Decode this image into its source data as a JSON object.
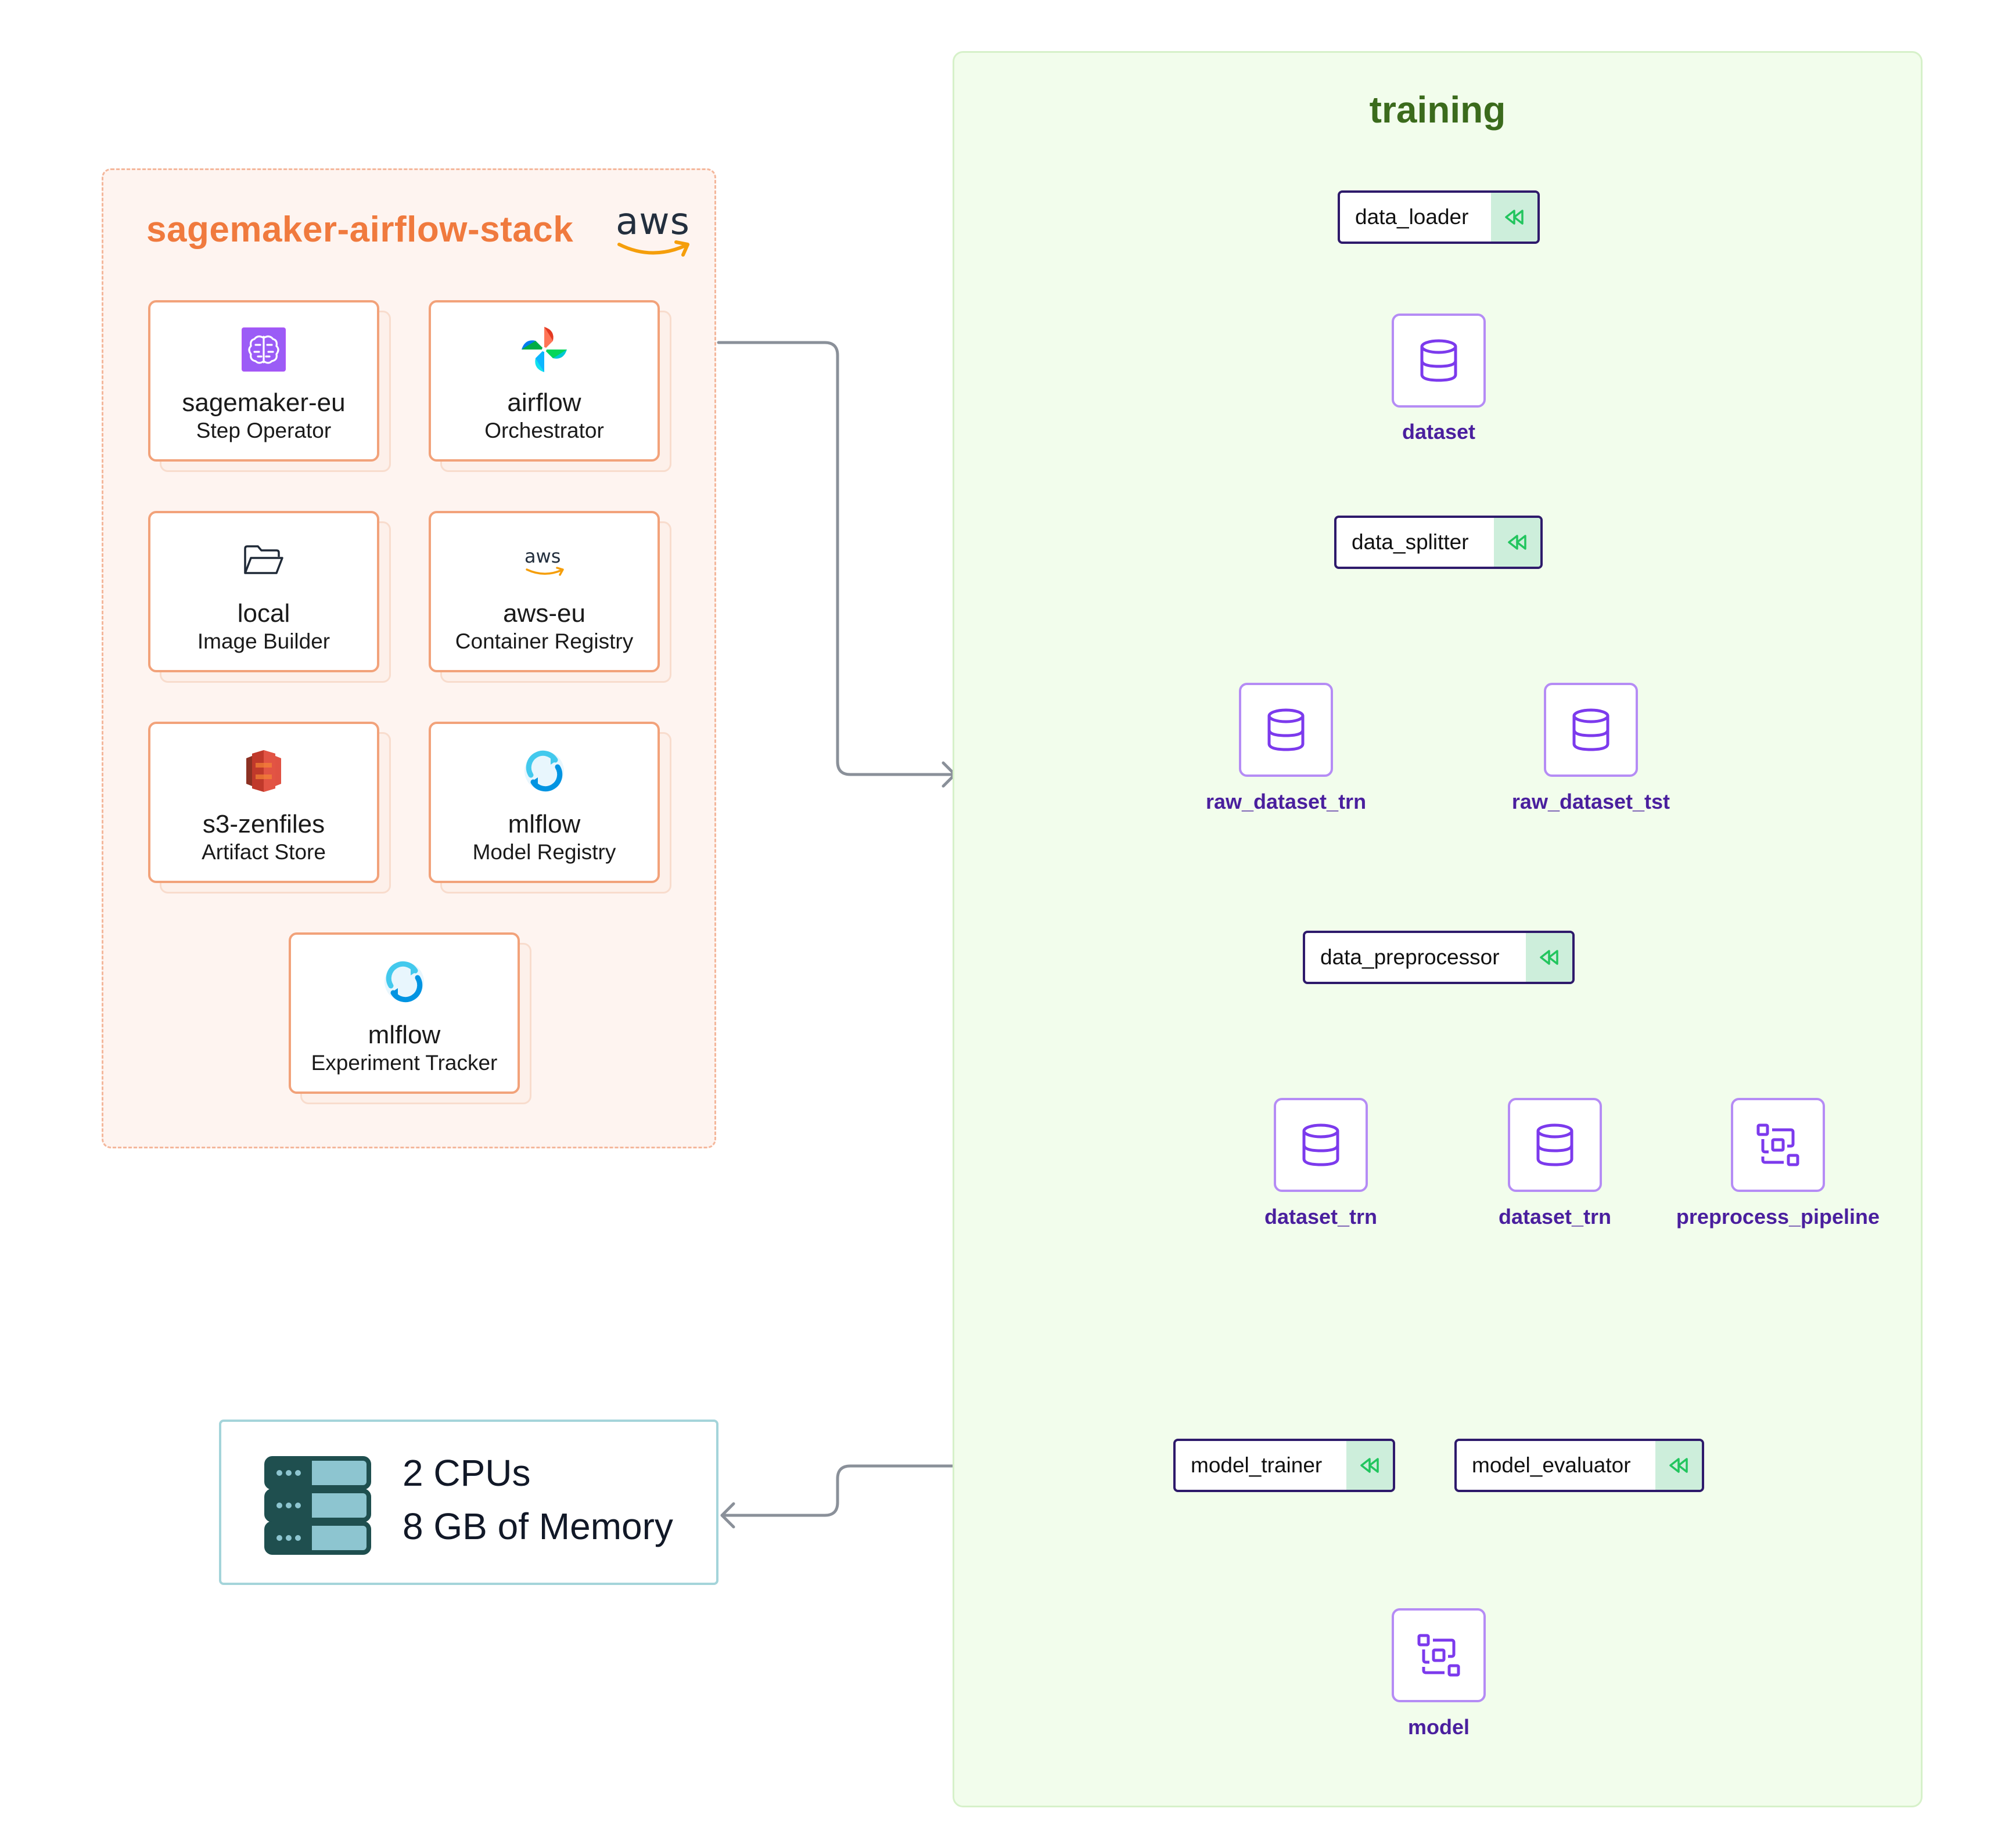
{
  "stack": {
    "title": "sagemaker-airflow-stack",
    "logo": "aws",
    "components": [
      {
        "name": "sagemaker-eu",
        "type": "Step Operator",
        "icon": "sagemaker-brain-icon"
      },
      {
        "name": "airflow",
        "type": "Orchestrator",
        "icon": "airflow-pinwheel-icon"
      },
      {
        "name": "local",
        "type": "Image Builder",
        "icon": "folder-icon"
      },
      {
        "name": "aws-eu",
        "type": "Container Registry",
        "icon": "aws-logo-icon",
        "logo_text": "aws"
      },
      {
        "name": "s3-zenfiles",
        "type": "Artifact Store",
        "icon": "s3-bucket-icon"
      },
      {
        "name": "mlflow",
        "type": "Model Registry",
        "icon": "mlflow-icon"
      },
      {
        "name": "mlflow",
        "type": "Experiment Tracker",
        "icon": "mlflow-icon"
      }
    ]
  },
  "resources": {
    "cpus": "2 CPUs",
    "memory": "8 GB of Memory",
    "icon": "server-rack-icon"
  },
  "pipeline": {
    "title": "training",
    "steps": {
      "data_loader": "data_loader",
      "data_splitter": "data_splitter",
      "data_preprocessor": "data_preprocessor",
      "model_trainer": "model_trainer",
      "model_evaluator": "model_evaluator"
    },
    "artifacts": {
      "dataset": "dataset",
      "raw_dataset_trn": "raw_dataset_trn",
      "raw_dataset_tst": "raw_dataset_tst",
      "dataset_trn_1": "dataset_trn",
      "dataset_trn_2": "dataset_trn",
      "preprocess_pipeline": "preprocess_pipeline",
      "model": "model"
    },
    "cache_icon": "cached-rewind-icon",
    "colors": {
      "step_border": "#2e1a6b",
      "artifact_border": "#b58cf5",
      "artifact_label": "#4a1f9e",
      "cache_bg": "#cdeedb",
      "cache_icon": "#22c55e",
      "edge": "#cfd3da",
      "stack_accent": "#f07a3e",
      "training_title": "#3b6b1c"
    }
  }
}
